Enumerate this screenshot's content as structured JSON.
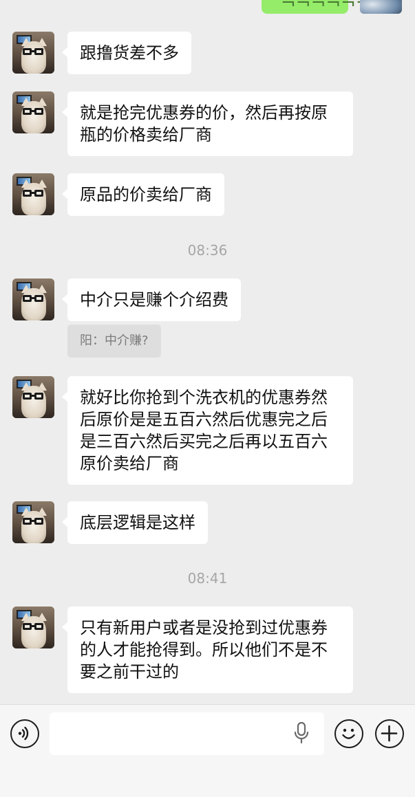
{
  "header_partial": {
    "outgoing_text": "¬¬¬¬¬¬"
  },
  "messages": [
    {
      "text": "跟撸货差不多"
    },
    {
      "text": "就是抢完优惠券的价，然后再按原\n瓶的价格卖给厂商"
    },
    {
      "text": "原品的价卖给厂商"
    },
    {
      "time": "08:36"
    },
    {
      "text": "中介只是赚个介绍费",
      "quote": "阳：中介赚?"
    },
    {
      "text": "就好比你抢到个洗衣机的优惠券然\n后原价是是五百六然后优惠完之后\n是三百六然后买完之后再以五百六\n原价卖给厂商"
    },
    {
      "text": "底层逻辑是这样"
    },
    {
      "time": "08:41"
    },
    {
      "text": "只有新用户或者是没抢到过优惠券\n的人才能抢得到。所以他们不是不\n要之前干过的"
    }
  ],
  "input_bar": {
    "value": "",
    "placeholder": ""
  },
  "icons": {
    "voice": "voice-icon",
    "mic": "microphone-icon",
    "emoji": "emoji-icon",
    "plus": "plus-icon",
    "avatar": "cat-avatar"
  },
  "colors": {
    "background": "#ededed",
    "bubble_in": "#ffffff",
    "bubble_out": "#95ec69",
    "quote_bg": "#dedede",
    "time_text": "#a6a6a6"
  }
}
